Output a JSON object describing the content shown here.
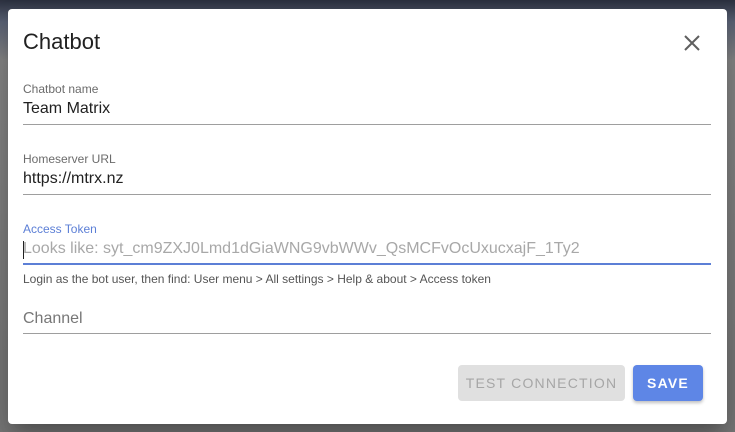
{
  "dialog": {
    "title": "Chatbot",
    "close_icon": "close-icon"
  },
  "fields": {
    "name": {
      "label": "Chatbot name",
      "value": "Team Matrix"
    },
    "homeserver": {
      "label": "Homeserver URL",
      "value": "https://mtrx.nz"
    },
    "token": {
      "label": "Access Token",
      "value": "",
      "placeholder": "Looks like: syt_cm9ZXJ0Lmd1dGiaWNG9vbWWv_QsMCFvOcUxucxajF_1Ty2",
      "hint": "Login as the bot user, then find: User menu > All settings > Help & about > Access token"
    },
    "channel": {
      "label": "",
      "value": "",
      "placeholder": "Channel"
    }
  },
  "buttons": {
    "test": "TEST CONNECTION",
    "save": "SAVE"
  },
  "colors": {
    "accent": "#5c7fd6",
    "save_button": "#5e86e6",
    "disabled_button": "#e0e0e0"
  }
}
